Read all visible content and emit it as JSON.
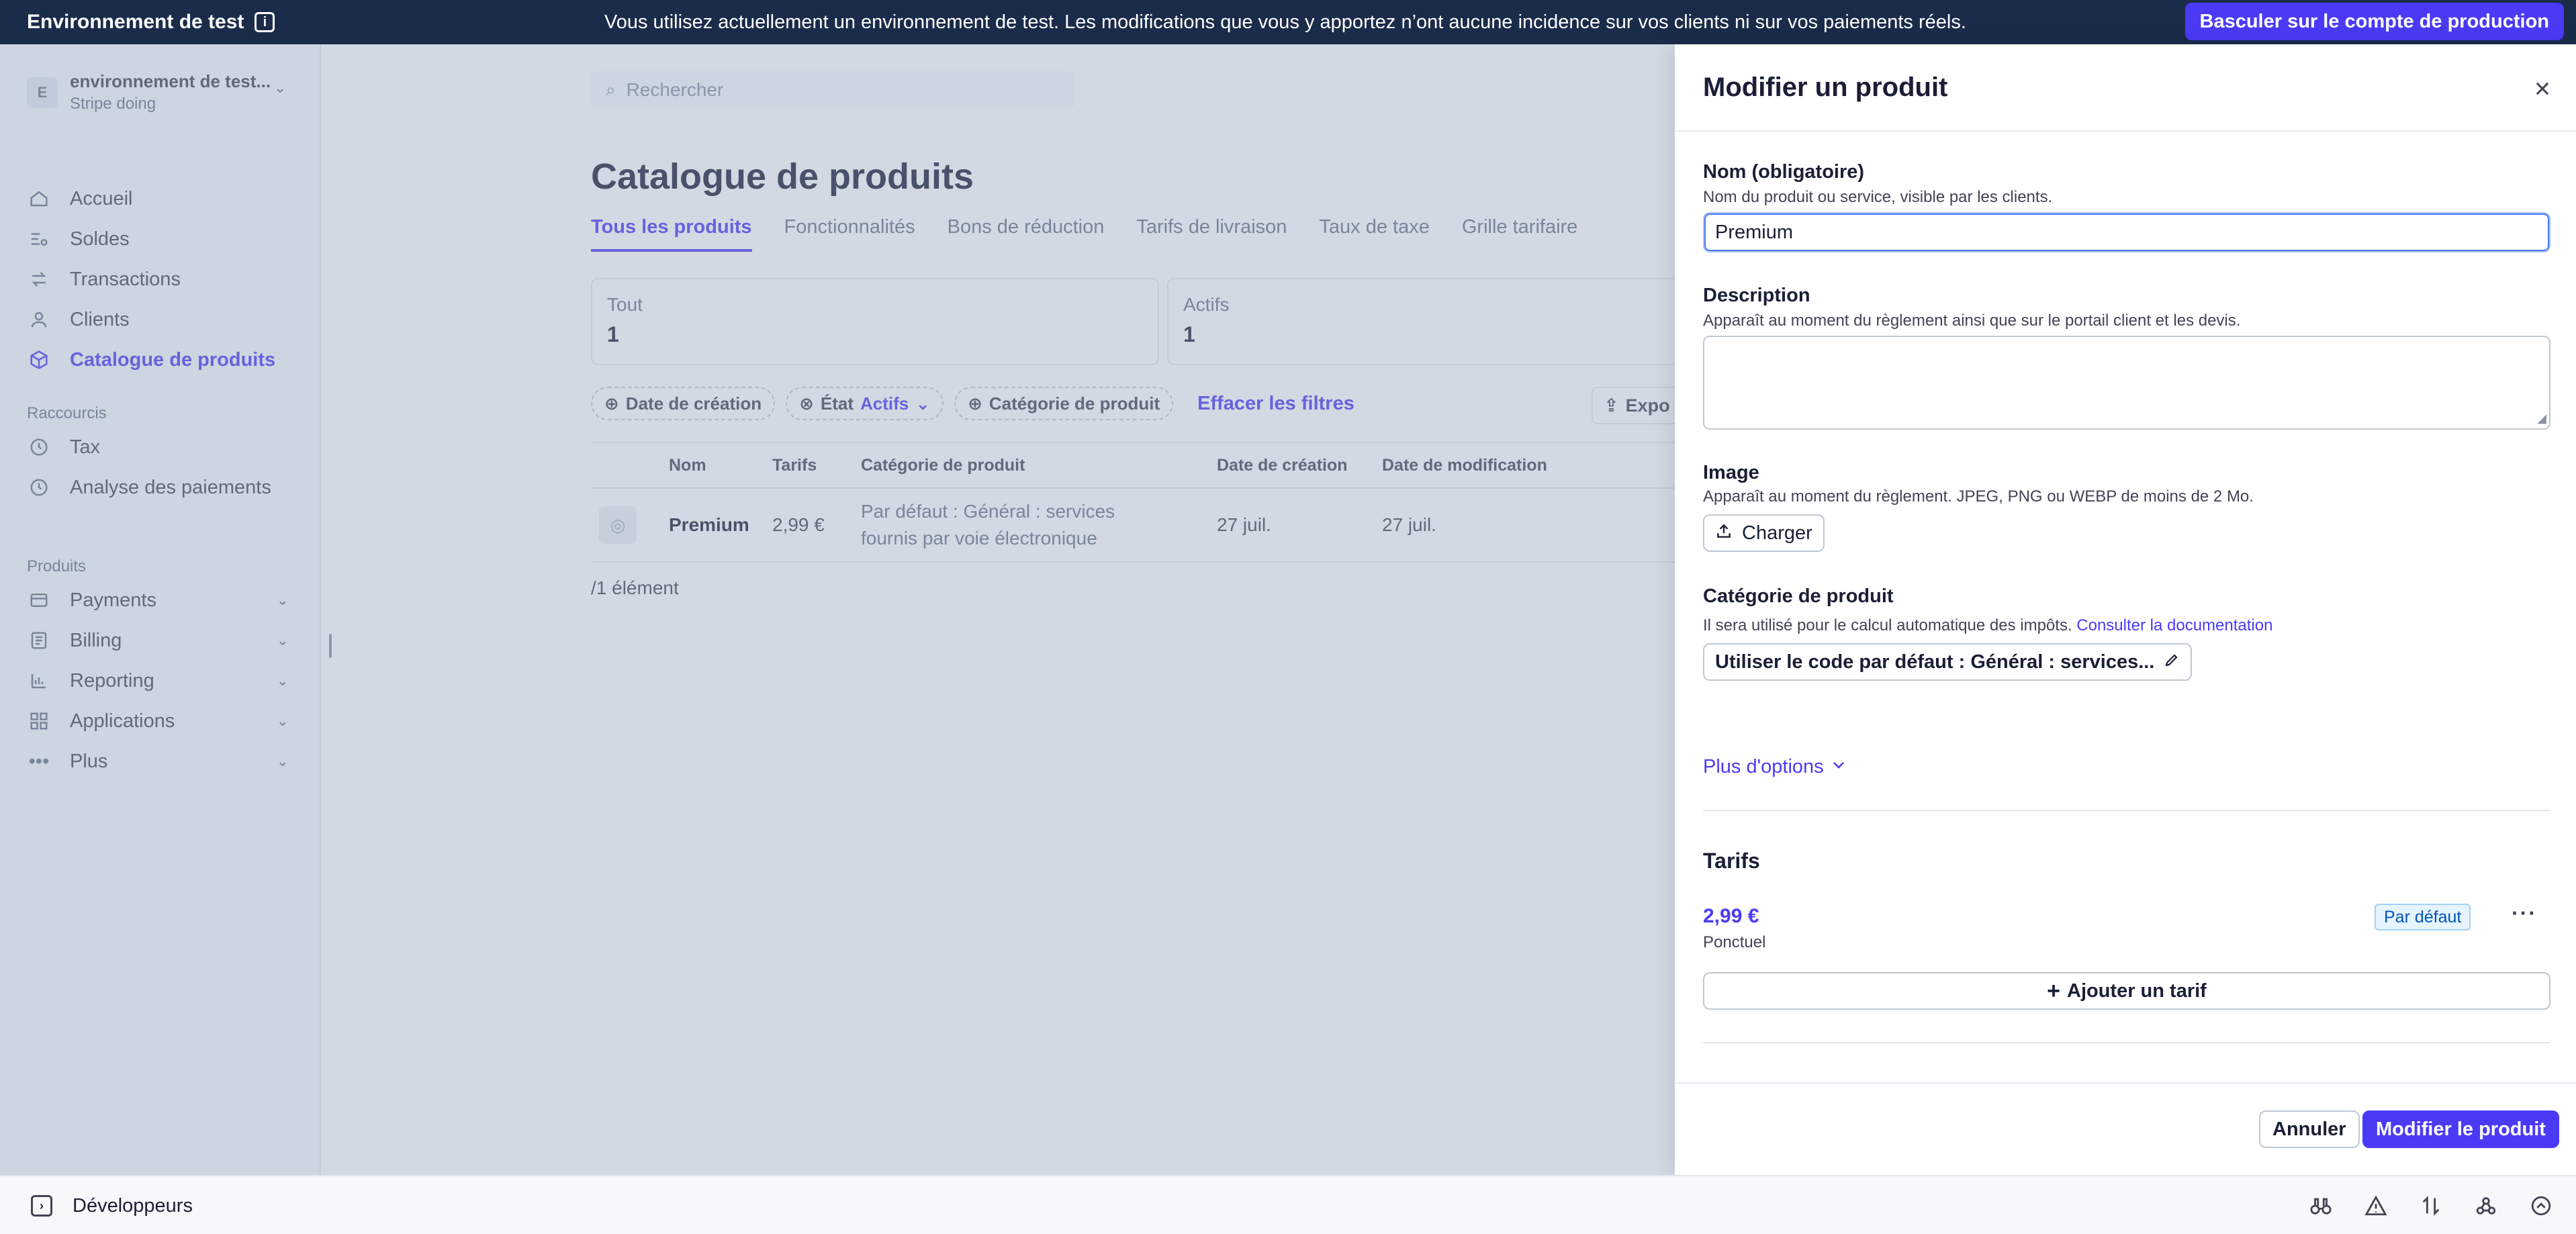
{
  "banner": {
    "title": "Environnement de test",
    "message": "Vous utilisez actuellement un environnement de test. Les modifications que vous y apportez n’ont aucune incidence sur vos clients ni sur vos paiements réels.",
    "switch_button": "Basculer sur le compte de production"
  },
  "account": {
    "avatar_letter": "E",
    "name": "environnement de test...",
    "org": "Stripe doing"
  },
  "sidebar": {
    "main_items": [
      {
        "label": "Accueil",
        "icon": "home-icon"
      },
      {
        "label": "Soldes",
        "icon": "balance-icon"
      },
      {
        "label": "Transactions",
        "icon": "arrows-icon"
      },
      {
        "label": "Clients",
        "icon": "user-icon"
      },
      {
        "label": "Catalogue de produits",
        "icon": "box-icon",
        "active": true
      }
    ],
    "shortcuts_label": "Raccourcis",
    "shortcuts": [
      {
        "label": "Tax",
        "icon": "clock-icon"
      },
      {
        "label": "Analyse des paiements",
        "icon": "clock-icon"
      }
    ],
    "products_label": "Produits",
    "products": [
      {
        "label": "Payments",
        "icon": "card-icon"
      },
      {
        "label": "Billing",
        "icon": "billing-icon"
      },
      {
        "label": "Reporting",
        "icon": "chart-icon"
      },
      {
        "label": "Applications",
        "icon": "apps-icon"
      },
      {
        "label": "Plus",
        "icon": "more-icon"
      }
    ]
  },
  "search": {
    "placeholder": "Rechercher"
  },
  "catalog": {
    "title": "Catalogue de produits",
    "tabs": [
      "Tous les produits",
      "Fonctionnalités",
      "Bons de réduction",
      "Tarifs de livraison",
      "Taux de taxe",
      "Grille tarifaire"
    ],
    "cards": [
      {
        "label": "Tout",
        "value": "1"
      },
      {
        "label": "Actifs",
        "value": "1"
      }
    ],
    "filters": {
      "date": "Date de création",
      "state": "État",
      "state_value": "Actifs",
      "category": "Catégorie de produit",
      "clear": "Effacer les filtres",
      "export": "Expo"
    },
    "table": {
      "columns": [
        "Nom",
        "Tarifs",
        "Catégorie de produit",
        "Date de création",
        "Date de modification"
      ],
      "rows": [
        {
          "name": "Premium",
          "price": "2,99 €",
          "category_line1": "Par défaut : Général : services",
          "category_line2": "fournis par voie électronique",
          "created": "27 juil.",
          "modified": "27 juil."
        }
      ]
    },
    "count": "/1 élément"
  },
  "drawer": {
    "title": "Modifier un produit",
    "name_label": "Nom (obligatoire)",
    "name_help": "Nom du produit ou service, visible par les clients.",
    "name_value": "Premium",
    "description_label": "Description",
    "description_help": "Apparaît au moment du règlement ainsi que sur le portail client et les devis.",
    "image_label": "Image",
    "image_help": "Apparaît au moment du règlement. JPEG, PNG ou WEBP de moins de 2 Mo.",
    "upload_button": "Charger",
    "category_label": "Catégorie de produit",
    "category_help": "Il sera utilisé pour le calcul automatique des impôts.",
    "category_link": "Consulter la documentation",
    "category_value": "Utiliser le code par défaut : Général : services...",
    "more_options": "Plus d'options",
    "prices_title": "Tarifs",
    "price_amount": "2,99 €",
    "price_type": "Ponctuel",
    "price_badge": "Par défaut",
    "add_price": "Ajouter un tarif",
    "cancel": "Annuler",
    "submit": "Modifier le produit"
  },
  "bottombar": {
    "developers": "Développeurs"
  },
  "colors": {
    "accent": "#4b3af5",
    "banner_bg": "#1a2c4a",
    "badge_bg": "#e6f4ff"
  }
}
